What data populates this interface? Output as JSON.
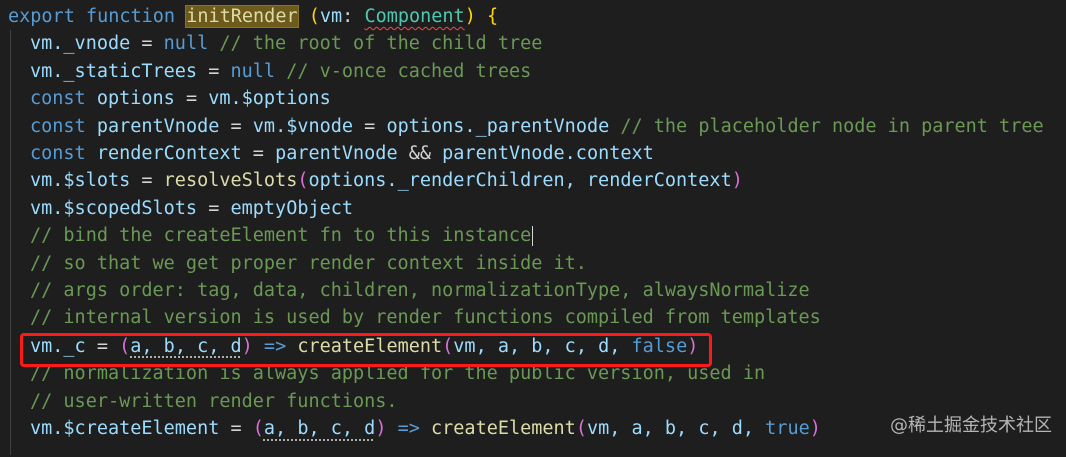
{
  "code": {
    "kw_export": "export",
    "kw_function": "function",
    "fn_name": "initRender",
    "param_open": "(",
    "param_vm": "vm",
    "colon": ":",
    "type_component": "Component",
    "param_close": ")",
    "brace_open": "{",
    "l2_a": "vm._vnode",
    "l2_eq": " = ",
    "l2_null": "null",
    "l2_comment": " // the root of the child tree",
    "l3_a": "vm._staticTrees",
    "l3_eq": " = ",
    "l3_null": "null",
    "l3_comment": " // v-once cached trees",
    "l4_const": "const",
    "l4_opts": "options",
    "l4_eq": " = ",
    "l4_rhs": "vm.$options",
    "l5_const": "const",
    "l5_pv": "parentVnode",
    "l5_eq": " = ",
    "l5_vm": "vm.$vnode",
    "l5_eq2": " = ",
    "l5_opv": "options._parentVnode",
    "l5_comment": " // the placeholder node in parent tree",
    "l6_const": "const",
    "l6_rc": "renderContext",
    "l6_eq": " = ",
    "l6_pv": "parentVnode",
    "l6_and": " && ",
    "l6_pvc": "parentVnode.context",
    "l7_slots": "vm.$slots",
    "l7_eq": " = ",
    "l7_fn": "resolveSlots",
    "l7_po": "(",
    "l7_args": "options._renderChildren, renderContext",
    "l7_pc": ")",
    "l8_ss": "vm.$scopedSlots",
    "l8_eq": " = ",
    "l8_eo": "emptyObject",
    "c1": "// bind the createElement fn to this instance",
    "c2": "// so that we get proper render context inside it.",
    "c3": "// args order: tag, data, children, normalizationType, alwaysNormalize",
    "c4": "// internal version is used by render functions compiled from templates",
    "l13_c": "vm._c",
    "l13_eq": " = ",
    "l13_po": "(",
    "l13_params": "a, b, c, d",
    "l13_pc": ")",
    "l13_arrow": " => ",
    "l13_fn": "createElement",
    "l13_po2": "(",
    "l13_args": "vm, a, b, c, d, ",
    "l13_false": "false",
    "l13_pc2": ")",
    "c5": "// normalization is always applied for the public version, used in",
    "c6": "// user-written render functions.",
    "l16_ce": "vm.$createElement",
    "l16_eq": " = ",
    "l16_po": "(",
    "l16_params": "a, b, c, d",
    "l16_pc": ")",
    "l16_arrow": " => ",
    "l16_fn": "createElement",
    "l16_po2": "(",
    "l16_args": "vm, a, b, c, d, ",
    "l16_true": "true",
    "l16_pc2": ")"
  },
  "watermark": "@稀土掘金技术社区",
  "colors": {
    "background": "#1e1e1e",
    "keyword": "#569cd6",
    "function": "#dcdcaa",
    "variable": "#9cdcfe",
    "type": "#4ec9b0",
    "comment": "#6a9955",
    "highlight_box": "#ff1a1a"
  }
}
